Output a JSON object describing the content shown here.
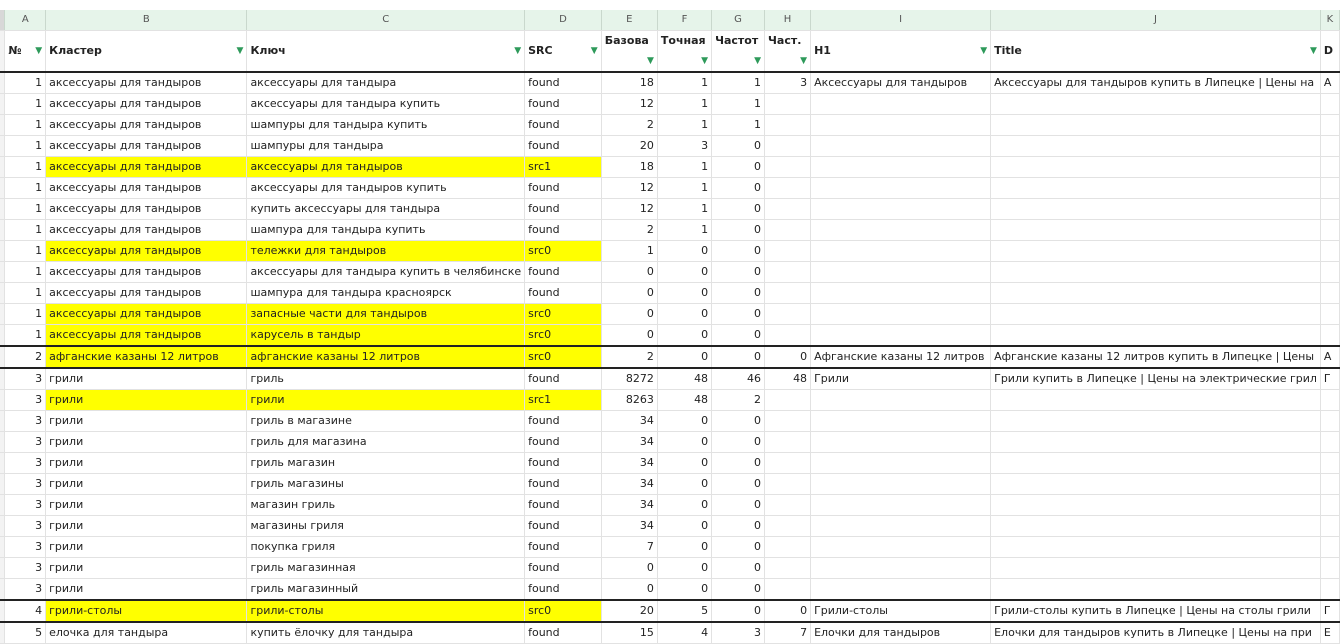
{
  "columns": [
    "A",
    "B",
    "C",
    "D",
    "E",
    "F",
    "G",
    "H",
    "I",
    "J",
    "K"
  ],
  "headers": [
    "№",
    "Кластер",
    "Ключ",
    "SRC",
    "Базова",
    "Точная",
    "Частот",
    "Част.",
    "H1",
    "Title",
    "D"
  ],
  "colors": {
    "highlight": "#ffff00",
    "header_bg": "#e6f4ea",
    "filter": "#2e9a5a"
  },
  "rows": [
    {
      "n": "1",
      "cluster": "аксессуары для тандыров",
      "key": "аксессуары для тандыра",
      "src": "found",
      "e": "18",
      "f": "1",
      "g": "1",
      "h": "3",
      "h1": "Аксессуары для тандыров",
      "title": "Аксессуары для тандыров купить в Липецке | Цены на",
      "k": "А",
      "hl": false,
      "sep": false
    },
    {
      "n": "1",
      "cluster": "аксессуары для тандыров",
      "key": "аксессуары для тандыра купить",
      "src": "found",
      "e": "12",
      "f": "1",
      "g": "1",
      "h": "",
      "h1": "",
      "title": "",
      "k": "",
      "hl": false,
      "sep": false
    },
    {
      "n": "1",
      "cluster": "аксессуары для тандыров",
      "key": "шампуры для тандыра купить",
      "src": "found",
      "e": "2",
      "f": "1",
      "g": "1",
      "h": "",
      "h1": "",
      "title": "",
      "k": "",
      "hl": false,
      "sep": false
    },
    {
      "n": "1",
      "cluster": "аксессуары для тандыров",
      "key": "шампуры для тандыра",
      "src": "found",
      "e": "20",
      "f": "3",
      "g": "0",
      "h": "",
      "h1": "",
      "title": "",
      "k": "",
      "hl": false,
      "sep": false
    },
    {
      "n": "1",
      "cluster": "аксессуары для тандыров",
      "key": "аксессуары для тандыров",
      "src": "src1",
      "e": "18",
      "f": "1",
      "g": "0",
      "h": "",
      "h1": "",
      "title": "",
      "k": "",
      "hl": true,
      "sep": false
    },
    {
      "n": "1",
      "cluster": "аксессуары для тандыров",
      "key": "аксессуары для тандыров купить",
      "src": "found",
      "e": "12",
      "f": "1",
      "g": "0",
      "h": "",
      "h1": "",
      "title": "",
      "k": "",
      "hl": false,
      "sep": false
    },
    {
      "n": "1",
      "cluster": "аксессуары для тандыров",
      "key": "купить аксессуары для тандыра",
      "src": "found",
      "e": "12",
      "f": "1",
      "g": "0",
      "h": "",
      "h1": "",
      "title": "",
      "k": "",
      "hl": false,
      "sep": false
    },
    {
      "n": "1",
      "cluster": "аксессуары для тандыров",
      "key": "шампура для тандыра купить",
      "src": "found",
      "e": "2",
      "f": "1",
      "g": "0",
      "h": "",
      "h1": "",
      "title": "",
      "k": "",
      "hl": false,
      "sep": false
    },
    {
      "n": "1",
      "cluster": "аксессуары для тандыров",
      "key": "тележки для тандыров",
      "src": "src0",
      "e": "1",
      "f": "0",
      "g": "0",
      "h": "",
      "h1": "",
      "title": "",
      "k": "",
      "hl": true,
      "sep": false
    },
    {
      "n": "1",
      "cluster": "аксессуары для тандыров",
      "key": "аксессуары для тандыра купить в челябинске",
      "src": "found",
      "e": "0",
      "f": "0",
      "g": "0",
      "h": "",
      "h1": "",
      "title": "",
      "k": "",
      "hl": false,
      "sep": false
    },
    {
      "n": "1",
      "cluster": "аксессуары для тандыров",
      "key": "шампура для тандыра красноярск",
      "src": "found",
      "e": "0",
      "f": "0",
      "g": "0",
      "h": "",
      "h1": "",
      "title": "",
      "k": "",
      "hl": false,
      "sep": false
    },
    {
      "n": "1",
      "cluster": "аксессуары для тандыров",
      "key": "запасные части для тандыров",
      "src": "src0",
      "e": "0",
      "f": "0",
      "g": "0",
      "h": "",
      "h1": "",
      "title": "",
      "k": "",
      "hl": true,
      "sep": false
    },
    {
      "n": "1",
      "cluster": "аксессуары для тандыров",
      "key": "карусель в тандыр",
      "src": "src0",
      "e": "0",
      "f": "0",
      "g": "0",
      "h": "",
      "h1": "",
      "title": "",
      "k": "",
      "hl": true,
      "sep": true
    },
    {
      "n": "2",
      "cluster": "афганские казаны 12 литров",
      "key": "афганские казаны 12 литров",
      "src": "src0",
      "e": "2",
      "f": "0",
      "g": "0",
      "h": "0",
      "h1": "Афганские казаны 12 литров",
      "title": "Афганские казаны 12 литров купить в Липецке | Цены",
      "k": "А",
      "hl": true,
      "sep": true
    },
    {
      "n": "3",
      "cluster": "грили",
      "key": "гриль",
      "src": "found",
      "e": "8272",
      "f": "48",
      "g": "46",
      "h": "48",
      "h1": "Грили",
      "title": "Грили купить в Липецке | Цены на электрические грил",
      "k": "Г",
      "hl": false,
      "sep": false
    },
    {
      "n": "3",
      "cluster": "грили",
      "key": "грили",
      "src": "src1",
      "e": "8263",
      "f": "48",
      "g": "2",
      "h": "",
      "h1": "",
      "title": "",
      "k": "",
      "hl": true,
      "sep": false
    },
    {
      "n": "3",
      "cluster": "грили",
      "key": "гриль в магазине",
      "src": "found",
      "e": "34",
      "f": "0",
      "g": "0",
      "h": "",
      "h1": "",
      "title": "",
      "k": "",
      "hl": false,
      "sep": false
    },
    {
      "n": "3",
      "cluster": "грили",
      "key": "гриль для магазина",
      "src": "found",
      "e": "34",
      "f": "0",
      "g": "0",
      "h": "",
      "h1": "",
      "title": "",
      "k": "",
      "hl": false,
      "sep": false
    },
    {
      "n": "3",
      "cluster": "грили",
      "key": "гриль магазин",
      "src": "found",
      "e": "34",
      "f": "0",
      "g": "0",
      "h": "",
      "h1": "",
      "title": "",
      "k": "",
      "hl": false,
      "sep": false
    },
    {
      "n": "3",
      "cluster": "грили",
      "key": "гриль магазины",
      "src": "found",
      "e": "34",
      "f": "0",
      "g": "0",
      "h": "",
      "h1": "",
      "title": "",
      "k": "",
      "hl": false,
      "sep": false
    },
    {
      "n": "3",
      "cluster": "грили",
      "key": "магазин гриль",
      "src": "found",
      "e": "34",
      "f": "0",
      "g": "0",
      "h": "",
      "h1": "",
      "title": "",
      "k": "",
      "hl": false,
      "sep": false
    },
    {
      "n": "3",
      "cluster": "грили",
      "key": "магазины гриля",
      "src": "found",
      "e": "34",
      "f": "0",
      "g": "0",
      "h": "",
      "h1": "",
      "title": "",
      "k": "",
      "hl": false,
      "sep": false
    },
    {
      "n": "3",
      "cluster": "грили",
      "key": "покупка гриля",
      "src": "found",
      "e": "7",
      "f": "0",
      "g": "0",
      "h": "",
      "h1": "",
      "title": "",
      "k": "",
      "hl": false,
      "sep": false
    },
    {
      "n": "3",
      "cluster": "грили",
      "key": "гриль магазинная",
      "src": "found",
      "e": "0",
      "f": "0",
      "g": "0",
      "h": "",
      "h1": "",
      "title": "",
      "k": "",
      "hl": false,
      "sep": false
    },
    {
      "n": "3",
      "cluster": "грили",
      "key": "гриль магазинный",
      "src": "found",
      "e": "0",
      "f": "0",
      "g": "0",
      "h": "",
      "h1": "",
      "title": "",
      "k": "",
      "hl": false,
      "sep": true
    },
    {
      "n": "4",
      "cluster": "грили-столы",
      "key": "грили-столы",
      "src": "src0",
      "e": "20",
      "f": "5",
      "g": "0",
      "h": "0",
      "h1": "Грили-столы",
      "title": "Грили-столы купить в Липецке | Цены на столы грили",
      "k": "Г",
      "hl": true,
      "sep": true
    },
    {
      "n": "5",
      "cluster": "елочка для тандыра",
      "key": "купить ёлочку для тандыра",
      "src": "found",
      "e": "15",
      "f": "4",
      "g": "3",
      "h": "7",
      "h1": "Елочки для тандыров",
      "title": "Елочки для тандыров купить в Липецке | Цены на при",
      "k": "Е",
      "hl": false,
      "sep": false
    }
  ]
}
